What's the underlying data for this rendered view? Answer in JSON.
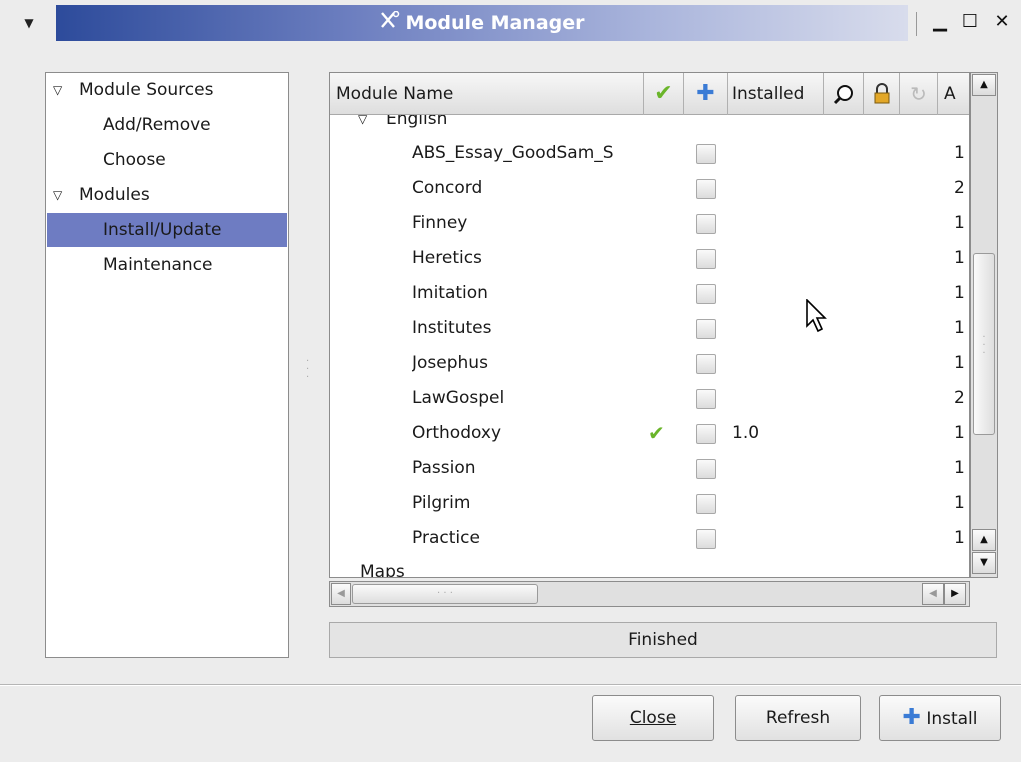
{
  "window": {
    "title": "Module Manager",
    "menu_icon": "dropdown-arrow-icon",
    "title_icon": "tools-icon",
    "controls": [
      "minimize-icon",
      "maximize-icon",
      "close-icon"
    ]
  },
  "sidebar": {
    "items": [
      {
        "label": "Module Sources",
        "expanded": true,
        "level": 0
      },
      {
        "label": "Add/Remove",
        "level": 1
      },
      {
        "label": "Choose",
        "level": 1
      },
      {
        "label": "Modules",
        "expanded": true,
        "level": 0
      },
      {
        "label": "Install/Update",
        "level": 1,
        "selected": true
      },
      {
        "label": "Maintenance",
        "level": 1
      }
    ]
  },
  "list": {
    "columns": {
      "name": "Module Name",
      "installed": "Installed",
      "trailing": "A"
    },
    "column_icons": [
      "checkmark-icon",
      "plus-icon",
      "magnifier-icon",
      "lock-icon",
      "refresh-icon"
    ],
    "group_top": "English",
    "group_bottom": "Maps",
    "rows": [
      {
        "name": "ABS_Essay_GoodSam_S",
        "ok": "",
        "installed": "",
        "trail": "1"
      },
      {
        "name": "Concord",
        "ok": "",
        "installed": "",
        "trail": "2"
      },
      {
        "name": "Finney",
        "ok": "",
        "installed": "",
        "trail": "1"
      },
      {
        "name": "Heretics",
        "ok": "",
        "installed": "",
        "trail": "1"
      },
      {
        "name": "Imitation",
        "ok": "",
        "installed": "",
        "trail": "1"
      },
      {
        "name": "Institutes",
        "ok": "",
        "installed": "",
        "trail": "1"
      },
      {
        "name": "Josephus",
        "ok": "",
        "installed": "",
        "trail": "1"
      },
      {
        "name": "LawGospel",
        "ok": "",
        "installed": "",
        "trail": "2"
      },
      {
        "name": "Orthodoxy",
        "ok": "✔",
        "installed": "1.0",
        "trail": "1"
      },
      {
        "name": "Passion",
        "ok": "",
        "installed": "",
        "trail": "1"
      },
      {
        "name": "Pilgrim",
        "ok": "",
        "installed": "",
        "trail": "1"
      },
      {
        "name": "Practice",
        "ok": "",
        "installed": "",
        "trail": "1"
      }
    ]
  },
  "status": "Finished",
  "buttons": {
    "close": "Close",
    "refresh": "Refresh",
    "install": "Install"
  },
  "colors": {
    "selection": "#6e7cc2",
    "titlebar": "#2d4b9b",
    "check_green": "#6ab52a",
    "plus_blue": "#3a7bd5"
  }
}
